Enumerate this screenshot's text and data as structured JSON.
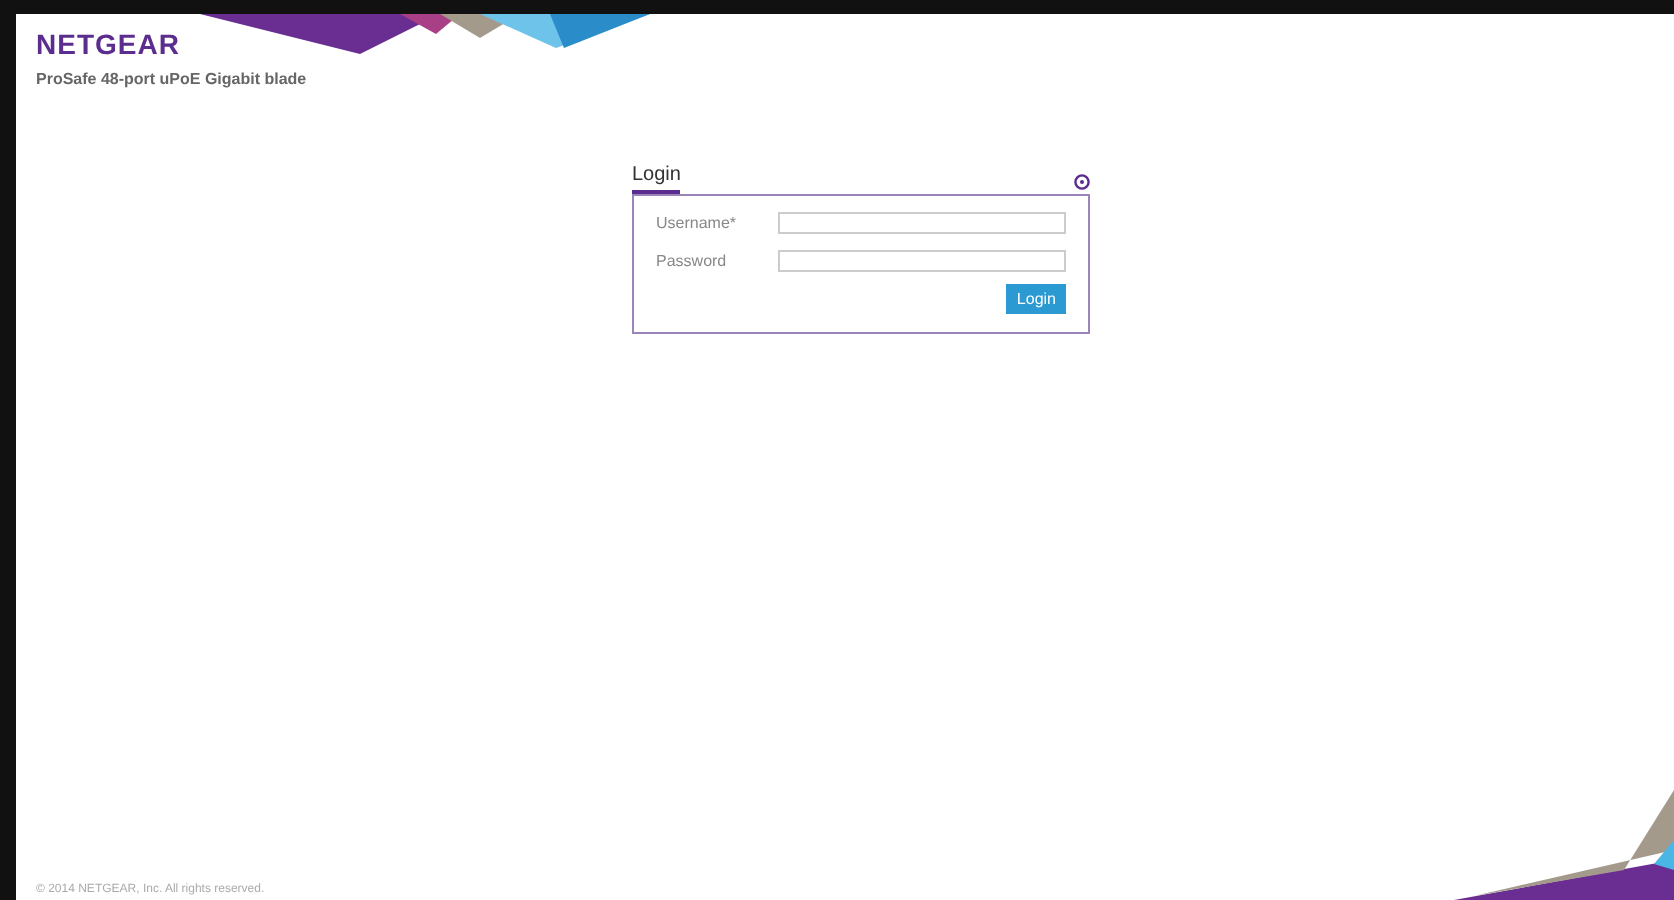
{
  "brand": {
    "logo": "NETGEAR",
    "product": "ProSafe 48-port uPoE Gigabit blade"
  },
  "login": {
    "title": "Login",
    "fields": [
      {
        "label": "Username*"
      },
      {
        "label": "Password"
      }
    ],
    "button": "Login"
  },
  "footer": "© 2014 NETGEAR, Inc. All rights reserved."
}
